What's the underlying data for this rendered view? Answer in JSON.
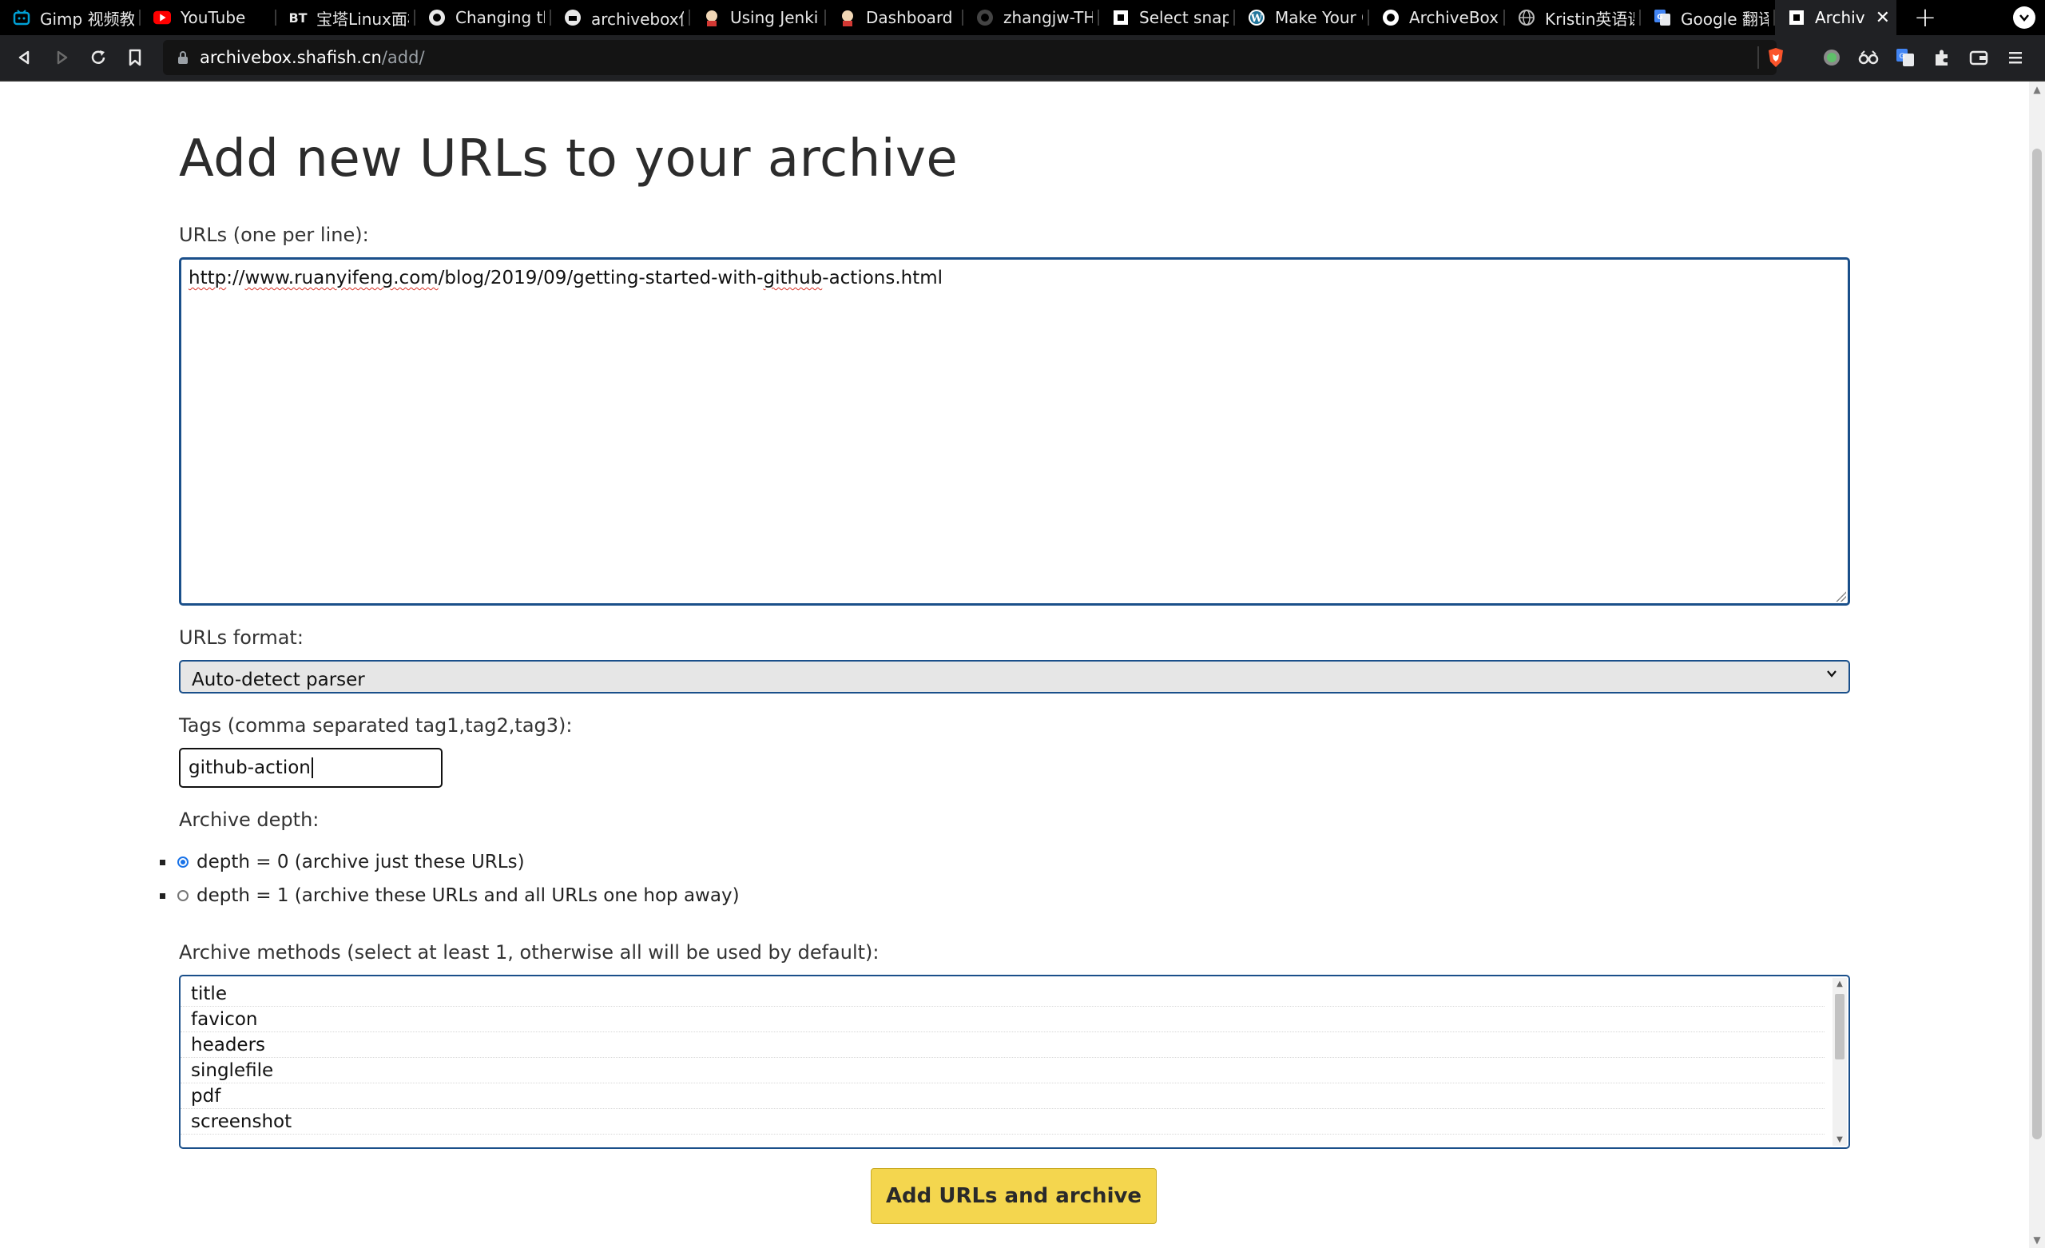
{
  "browser": {
    "tabs": [
      {
        "label": "Gimp 视频教",
        "favicon": "bilibili-icon",
        "color": "#00a1d6"
      },
      {
        "label": "YouTube",
        "favicon": "youtube-icon",
        "color": "#ff0000"
      },
      {
        "label": "宝塔Linux面板",
        "favicon": "bt-icon",
        "fav_text": "BT",
        "color": "#20a53a"
      },
      {
        "label": "Changing the",
        "favicon": "github-icon",
        "color": "#ffffff"
      },
      {
        "label": "archivebox使",
        "favicon": "docker-icon",
        "color": "#ffffff"
      },
      {
        "label": "Using Jenkins",
        "favicon": "jenkins-icon",
        "color": "#d33833"
      },
      {
        "label": "Dashboard [J",
        "favicon": "jenkins-icon",
        "color": "#d33833"
      },
      {
        "label": "zhangjw-THU",
        "favicon": "github-icon",
        "color": "#444444"
      },
      {
        "label": "Select snapsh",
        "favicon": "archivebox-icon",
        "color": "#ffffff"
      },
      {
        "label": "Make Your O",
        "favicon": "wordpress-icon",
        "color": "#ffffff"
      },
      {
        "label": "ArchiveBox/A",
        "favicon": "github-icon",
        "color": "#ffffff"
      },
      {
        "label": "Kristin英语课",
        "favicon": "globe-icon",
        "color": "#bbbbbb"
      },
      {
        "label": "Google 翻译",
        "favicon": "google-translate-icon",
        "color": "#4285f4"
      },
      {
        "label": "Archived",
        "favicon": "archivebox-icon",
        "color": "#ffffff",
        "active": true
      }
    ],
    "new_tab": "+",
    "close_glyph": "✕",
    "url_host": "archivebox.shafish.cn",
    "url_path": "/add/"
  },
  "page": {
    "title": "Add new URLs to your archive",
    "urls_label": "URLs (one per line):",
    "urls_value": {
      "part1": "http",
      "part2": "://",
      "part3": "www.ruanyifeng.com",
      "part4": "/blog/2019/09/getting-started-with-",
      "part5": "github",
      "part6": "-actions.html"
    },
    "format_label": "URLs format:",
    "format_value": "Auto-detect parser",
    "tags_label": "Tags (comma separated tag1,tag2,tag3):",
    "tags_value": "github-action",
    "depth_label": "Archive depth:",
    "depth_options": [
      {
        "label": "depth = 0 (archive just these URLs)",
        "checked": true
      },
      {
        "label": "depth = 1 (archive these URLs and all URLs one hop away)",
        "checked": false
      }
    ],
    "methods_label": "Archive methods (select at least 1, otherwise all will be used by default):",
    "methods": [
      "title",
      "favicon",
      "headers",
      "singlefile",
      "pdf",
      "screenshot"
    ],
    "submit_label": "Add URLs and archive"
  },
  "colors": {
    "accent": "#1a4f8a",
    "button": "#f4d64e"
  }
}
